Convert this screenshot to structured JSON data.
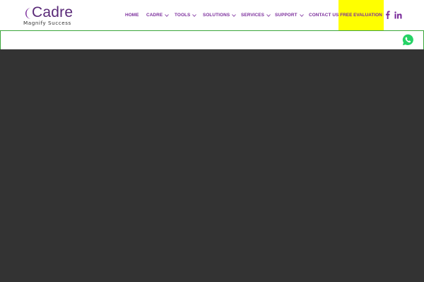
{
  "logo": {
    "word": "Cadre",
    "tagline": "Magnify Success"
  },
  "nav": {
    "items": [
      {
        "label": "HOME",
        "dropdown": false
      },
      {
        "label": "CADRE",
        "dropdown": true
      },
      {
        "label": "TOOLS",
        "dropdown": true
      },
      {
        "label": "SOLUTIONS",
        "dropdown": true
      },
      {
        "label": "SERVICES",
        "dropdown": true
      },
      {
        "label": "SUPPORT",
        "dropdown": true
      },
      {
        "label": "CONTACT US",
        "dropdown": false
      }
    ],
    "cta_label": "FREE EVALUATION"
  },
  "social": {
    "icons": [
      "facebook-icon",
      "linkedin-icon"
    ]
  },
  "floating": {
    "icon": "whatsapp-icon"
  },
  "colors": {
    "brand_purple": "#7b2d9c",
    "logo_purple": "#5a2a78",
    "cta_yellow": "#ffff00",
    "bar_border_green": "#3aa53a",
    "whatsapp_green": "#25d366",
    "content_bg": "#333333"
  }
}
